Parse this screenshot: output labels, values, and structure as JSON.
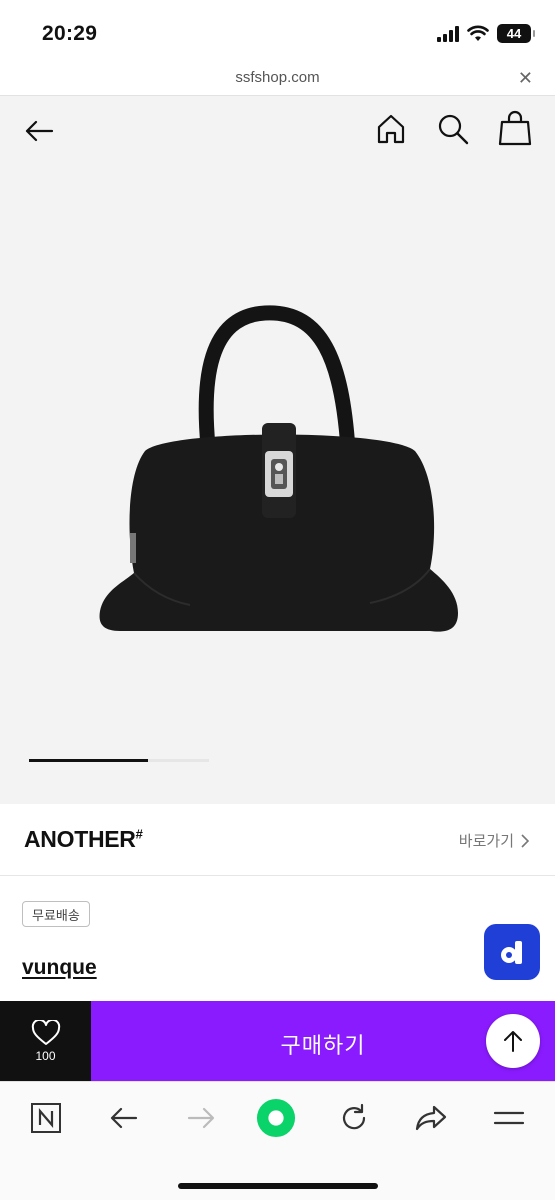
{
  "status_bar": {
    "time": "20:29",
    "battery": "44"
  },
  "browser": {
    "url": "ssfshop.com",
    "close_icon": "close-icon"
  },
  "header": {
    "icons": [
      "back-arrow-icon",
      "home-icon",
      "search-icon",
      "shopping-bag-icon"
    ]
  },
  "gallery": {
    "image": "black leather handbag",
    "page_progress": 0.66
  },
  "brand": {
    "name": "ANOTHER",
    "name_mark": "#",
    "link_label": "바로가기"
  },
  "product": {
    "badge": "무료배송",
    "name": "vunque"
  },
  "buy_bar": {
    "wish_count": "100",
    "buy_label": "구매하기",
    "accent": "#8a1bff"
  },
  "toolbar": {
    "icons": [
      "naver-n-icon",
      "back-arrow-icon",
      "forward-arrow-icon",
      "green-dot-icon",
      "refresh-icon",
      "share-icon",
      "menu-icon"
    ]
  }
}
